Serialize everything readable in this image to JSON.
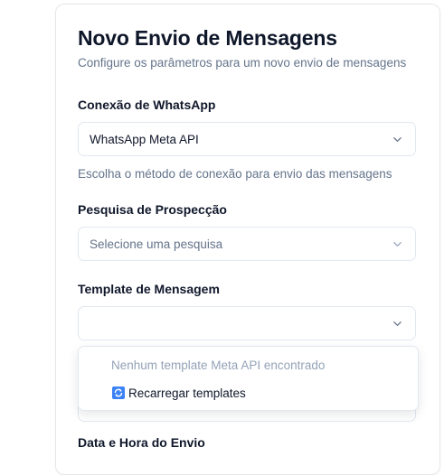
{
  "form": {
    "title": "Novo Envio de Mensagens",
    "subtitle": "Configure os parâmetros para um novo envio de mensagens",
    "connection": {
      "label": "Conexão de WhatsApp",
      "value": "WhatsApp Meta API",
      "helper": "Escolha o método de conexão para envio das mensagens"
    },
    "survey": {
      "label": "Pesquisa de Prospecção",
      "placeholder": "Selecione uma pesquisa"
    },
    "template": {
      "label": "Template de Mensagem",
      "value": "",
      "dropdown": {
        "empty_text": "Nenhum template Meta API encontrado",
        "reload_label": "Recarregar templates",
        "reload_icon": "refresh-icon"
      }
    },
    "schedule": {
      "label": "Data e Hora do Envio"
    }
  },
  "colors": {
    "text": "#0f172a",
    "muted": "#64748b",
    "border": "#e2e8f0",
    "reload_icon_bg": "#3b82f6"
  }
}
